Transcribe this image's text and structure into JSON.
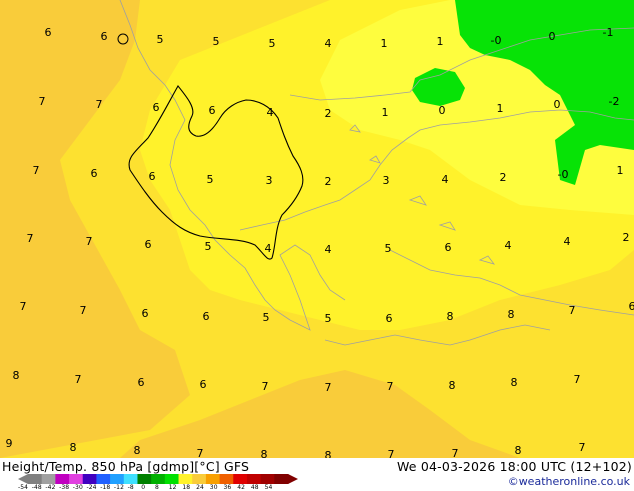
{
  "map": {
    "region": "Balkans / Aegean",
    "colors": {
      "temp_6_8": "#f9cc3a",
      "temp_4_6": "#fde130",
      "temp_2_4": "#fff22b",
      "temp_0_2": "#fefd3e",
      "temp_below_0": "#07e306",
      "coastline": "#a0a0a0",
      "contour": "#000000"
    },
    "labels": [
      {
        "v": "6"
      },
      {
        "v": "6"
      },
      {
        "v": "5"
      },
      {
        "v": "5"
      },
      {
        "v": "5"
      },
      {
        "v": "4"
      },
      {
        "v": "1"
      },
      {
        "v": "1"
      },
      {
        "v": "-0"
      },
      {
        "v": "0"
      },
      {
        "v": "-1"
      },
      {
        "v": "7"
      },
      {
        "v": "7"
      },
      {
        "v": "6"
      },
      {
        "v": "6"
      },
      {
        "v": "4"
      },
      {
        "v": "2"
      },
      {
        "v": "1"
      },
      {
        "v": "0"
      },
      {
        "v": "1"
      },
      {
        "v": "0"
      },
      {
        "v": "-2"
      },
      {
        "v": "7"
      },
      {
        "v": "6"
      },
      {
        "v": "6"
      },
      {
        "v": "5"
      },
      {
        "v": "3"
      },
      {
        "v": "2"
      },
      {
        "v": "3"
      },
      {
        "v": "4"
      },
      {
        "v": "2"
      },
      {
        "v": "-0"
      },
      {
        "v": "1"
      },
      {
        "v": "7"
      },
      {
        "v": "7"
      },
      {
        "v": "6"
      },
      {
        "v": "5"
      },
      {
        "v": "4"
      },
      {
        "v": "4"
      },
      {
        "v": "5"
      },
      {
        "v": "6"
      },
      {
        "v": "4"
      },
      {
        "v": "4"
      },
      {
        "v": "2"
      },
      {
        "v": "7"
      },
      {
        "v": "7"
      },
      {
        "v": "6"
      },
      {
        "v": "6"
      },
      {
        "v": "5"
      },
      {
        "v": "5"
      },
      {
        "v": "6"
      },
      {
        "v": "8"
      },
      {
        "v": "8"
      },
      {
        "v": "7"
      },
      {
        "v": "6"
      },
      {
        "v": "8"
      },
      {
        "v": "7"
      },
      {
        "v": "6"
      },
      {
        "v": "6"
      },
      {
        "v": "7"
      },
      {
        "v": "7"
      },
      {
        "v": "7"
      },
      {
        "v": "8"
      },
      {
        "v": "8"
      },
      {
        "v": "7"
      },
      {
        "v": "9"
      },
      {
        "v": "8"
      },
      {
        "v": "8"
      },
      {
        "v": "7"
      },
      {
        "v": "8"
      },
      {
        "v": "8"
      },
      {
        "v": "7"
      },
      {
        "v": "7"
      },
      {
        "v": "8"
      },
      {
        "v": "7"
      }
    ]
  },
  "footer": {
    "title_left": "Height/Temp. 850 hPa [gdmp][°C] GFS",
    "title_right": "We 04-03-2026 18:00 UTC (12+102)",
    "credit": "©weatheronline.co.uk",
    "scale_labels": [
      "-54",
      "-48",
      "-42",
      "-38",
      "-30",
      "-24",
      "-18",
      "-12",
      "-8",
      "0",
      "8",
      "12",
      "18",
      "24",
      "30",
      "36",
      "42",
      "48",
      "54"
    ],
    "scale_colors": [
      "#808080",
      "#a0a0a0",
      "#c000c0",
      "#e040e0",
      "#4000c0",
      "#2060ff",
      "#20a0ff",
      "#40e0ff",
      "#008000",
      "#00b000",
      "#00e000",
      "#fff22b",
      "#f9cc3a",
      "#f8a000",
      "#f06000",
      "#e00000",
      "#c00000",
      "#a00000",
      "#800000"
    ]
  }
}
